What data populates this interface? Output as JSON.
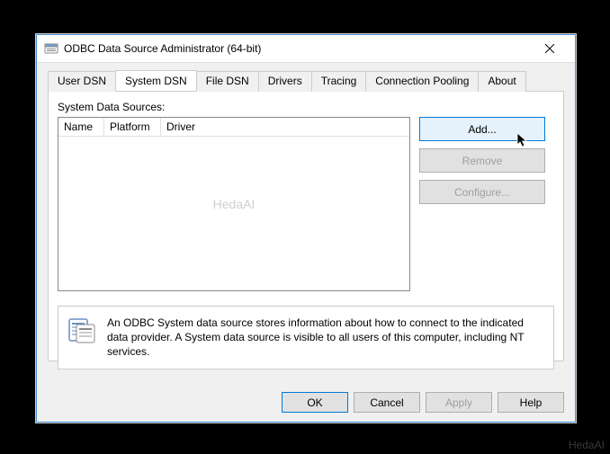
{
  "window": {
    "title": "ODBC Data Source Administrator (64-bit)"
  },
  "tabs": {
    "user_dsn": "User DSN",
    "system_dsn": "System DSN",
    "file_dsn": "File DSN",
    "drivers": "Drivers",
    "tracing": "Tracing",
    "connection_pooling": "Connection Pooling",
    "about": "About"
  },
  "system_dsn_page": {
    "label": "System Data Sources:",
    "columns": {
      "name": "Name",
      "platform": "Platform",
      "driver": "Driver"
    },
    "buttons": {
      "add": "Add...",
      "remove": "Remove",
      "configure": "Configure..."
    },
    "info": "An ODBC System data source stores information about how to connect to the indicated data provider. A System data source is visible to all users of this computer, including NT services."
  },
  "dialog_buttons": {
    "ok": "OK",
    "cancel": "Cancel",
    "apply": "Apply",
    "help": "Help"
  },
  "watermark": "HedaAI"
}
